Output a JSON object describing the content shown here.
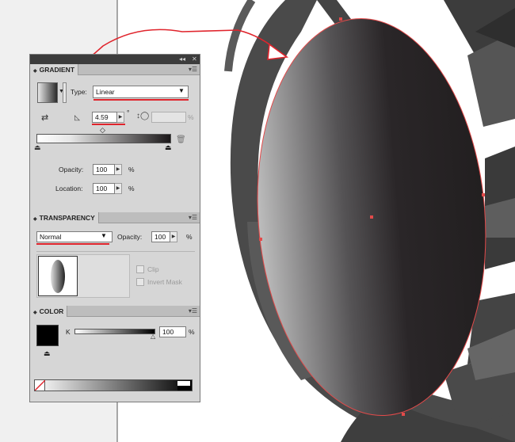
{
  "gradient_panel": {
    "title": "GRADIENT",
    "type_label": "Type:",
    "type_value": "Linear",
    "angle_value": "4.59",
    "angle_unit": "°",
    "aspect_unit": "%",
    "opacity_label": "Opacity:",
    "opacity_value": "100",
    "opacity_unit": "%",
    "location_label": "Location:",
    "location_value": "100",
    "location_unit": "%"
  },
  "transparency_panel": {
    "title": "TRANSPARENCY",
    "blend_mode": "Normal",
    "opacity_label": "Opacity:",
    "opacity_value": "100",
    "opacity_unit": "%",
    "clip_label": "Clip",
    "invert_mask_label": "Invert Mask"
  },
  "color_panel": {
    "title": "COLOR",
    "channel_label": "K",
    "channel_value": "100",
    "channel_unit": "%"
  },
  "colors": {
    "annotation": "#e0242c",
    "panel_bg": "#d6d6d6",
    "selection_path": "#e24a4a"
  },
  "icons": [
    "collapse-panel-icon",
    "close-panel-icon",
    "panel-menu-icon",
    "reverse-gradient-icon",
    "angle-icon",
    "aspect-ratio-icon",
    "delete-stop-icon",
    "midpoint-diamond-icon",
    "color-stop-icon",
    "none-swatch-icon",
    "out-of-gamut-icon"
  ]
}
